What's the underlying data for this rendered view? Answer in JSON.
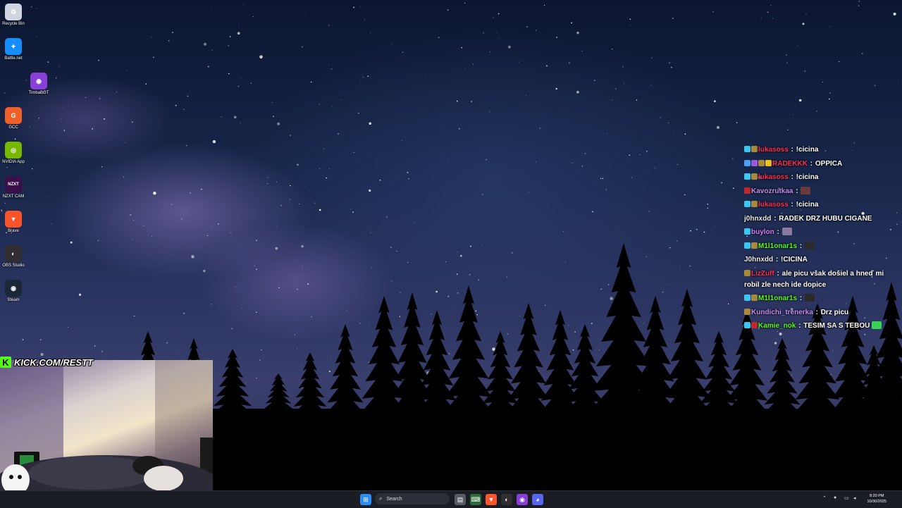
{
  "desktop_icons": [
    {
      "label": "Recycle Bin",
      "icon": "recycle-bin-icon",
      "color": "#cfd6df",
      "glyph": "♻"
    },
    {
      "label": "Battle.net",
      "icon": "battlenet-icon",
      "color": "#148eff",
      "glyph": "✦"
    },
    {
      "label": "TimbaBOT",
      "icon": "timbabot-icon",
      "color": "#8a3ed8",
      "glyph": "◉"
    },
    {
      "label": "GCC",
      "icon": "gcc-icon",
      "color": "#f0612a",
      "glyph": "G"
    },
    {
      "label": "NVIDIA App",
      "icon": "nvidia-icon",
      "color": "#76b900",
      "glyph": "◎"
    },
    {
      "label": "NZXT CAM",
      "icon": "nzxt-cam-icon",
      "color": "#3a0f4a",
      "glyph": "NZXT"
    },
    {
      "label": "Brave",
      "icon": "brave-icon",
      "color": "#fb542b",
      "glyph": "▼"
    },
    {
      "label": "OBS Studio",
      "icon": "obs-icon",
      "color": "#302e31",
      "glyph": "◐"
    },
    {
      "label": "Steam",
      "icon": "steam-icon",
      "color": "#1b2838",
      "glyph": "◉"
    }
  ],
  "chat": [
    {
      "badges": [
        "#3bc7f0",
        "#a88a3a"
      ],
      "user": "lukasoss",
      "color": "#ff2d55",
      "text": "!cicina",
      "emote": ""
    },
    {
      "badges": [
        "#4aa3f0",
        "#9b5ad9",
        "#a88a3a",
        "#f0c020"
      ],
      "user": "RADEKKK",
      "color": "#ff2d55",
      "text": "OPPICA",
      "emote": ""
    },
    {
      "badges": [
        "#3bc7f0",
        "#a88a3a"
      ],
      "user": "lukasoss",
      "color": "#ff2d55",
      "text": "!cicina",
      "emote": ""
    },
    {
      "badges": [
        "#c0282a"
      ],
      "user": "Kavozrutkaa",
      "color": "#c38cf0",
      "text": "",
      "emote": "#6b3a3a"
    },
    {
      "badges": [
        "#3bc7f0",
        "#a88a3a"
      ],
      "user": "lukasoss",
      "color": "#ff2d55",
      "text": "!cicina",
      "emote": ""
    },
    {
      "badges": [],
      "user": "j0hnxdd",
      "color": "#e8e8e8",
      "text": "RADEK DRZ HUBU CIGANE",
      "emote": ""
    },
    {
      "badges": [
        "#3bc7f0"
      ],
      "user": "buylon",
      "color": "#d77cff",
      "text": "",
      "emote": "#8a7aa0"
    },
    {
      "badges": [
        "#3bc7f0",
        "#a88a3a"
      ],
      "user": "M1l1onar1s",
      "color": "#53fc18",
      "text": "",
      "emote": "#2a2a2a"
    },
    {
      "badges": [],
      "user": "J0hnxdd",
      "color": "#e8e8e8",
      "text": "!CICINA",
      "emote": ""
    },
    {
      "badges": [
        "#a88a3a"
      ],
      "user": "LizZuff",
      "color": "#ff2d55",
      "text": "ale picu však došiel a hneď mi robil zle nech ide dopice",
      "emote": ""
    },
    {
      "badges": [
        "#3bc7f0",
        "#a88a3a"
      ],
      "user": "M1l1onar1s",
      "color": "#53fc18",
      "text": "",
      "emote": "#2a2a2a"
    },
    {
      "badges": [
        "#a88a3a"
      ],
      "user": "Kundichi_trenerka",
      "color": "#c38cf0",
      "text": "Drz picu",
      "emote": ""
    },
    {
      "badges": [
        "#3bc7f0",
        "#c0282a"
      ],
      "user": "Kamie_nok",
      "color": "#53fc18",
      "text": "TESIM SA S TEBOU",
      "emote": "#39d353"
    }
  ],
  "overlay": {
    "kick_logo": "K",
    "kick_url": "KICK.COM/RESTT"
  },
  "taskbar": {
    "search_placeholder": "Search",
    "time": "8:20 PM",
    "date": "10/30/2025",
    "apps": [
      {
        "icon": "windows-start-icon",
        "color": "#2b8cf5",
        "glyph": "⊞"
      },
      {
        "icon": "file-explorer-icon",
        "color": "#555a66",
        "glyph": "▤"
      },
      {
        "icon": "terminal-icon",
        "color": "#2f6b3a",
        "glyph": "⌨"
      },
      {
        "icon": "brave-icon",
        "color": "#fb542b",
        "glyph": "▼"
      },
      {
        "icon": "obs-icon",
        "color": "#302e31",
        "glyph": "◐"
      },
      {
        "icon": "timbabot-icon",
        "color": "#8a3ed8",
        "glyph": "◉"
      },
      {
        "icon": "discord-icon",
        "color": "#5865f2",
        "glyph": "◕"
      }
    ]
  }
}
